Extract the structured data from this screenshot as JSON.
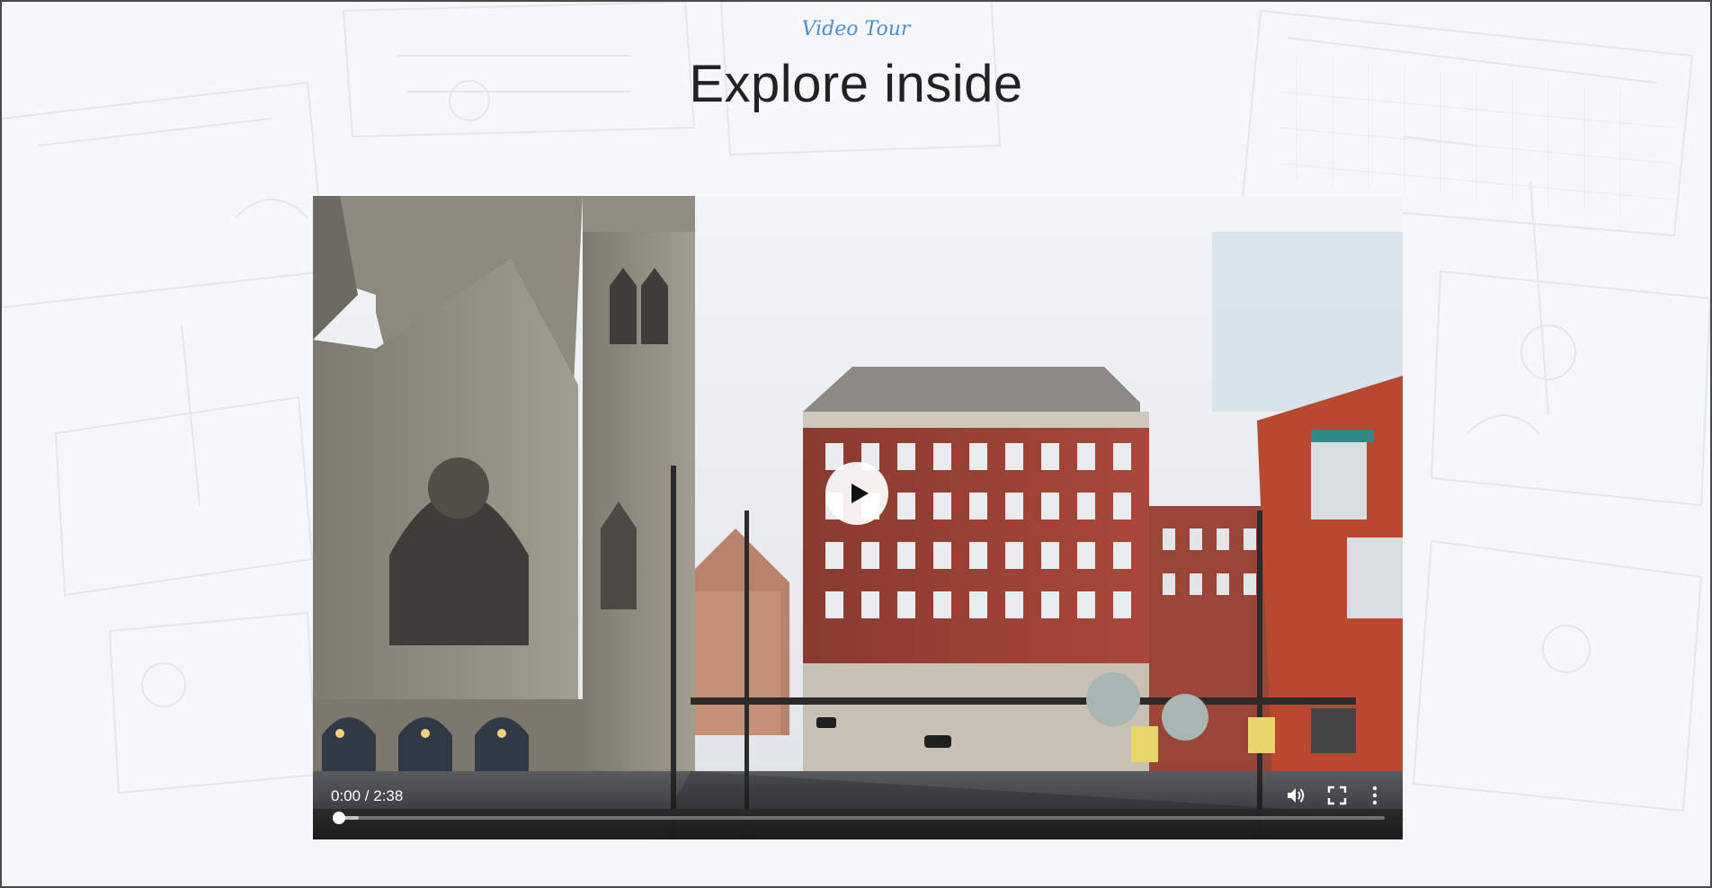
{
  "header": {
    "eyebrow": "Video Tour",
    "title": "Explore inside"
  },
  "player": {
    "time_display": "0:00 / 2:38",
    "progress": 0.0,
    "icons": {
      "play": "play-icon",
      "volume": "volume-icon",
      "fullscreen": "fullscreen-icon",
      "more": "more-vertical-icon"
    }
  },
  "colors": {
    "eyebrow": "#4a8fcf",
    "title": "#222222",
    "background": "#f5f7fa"
  }
}
